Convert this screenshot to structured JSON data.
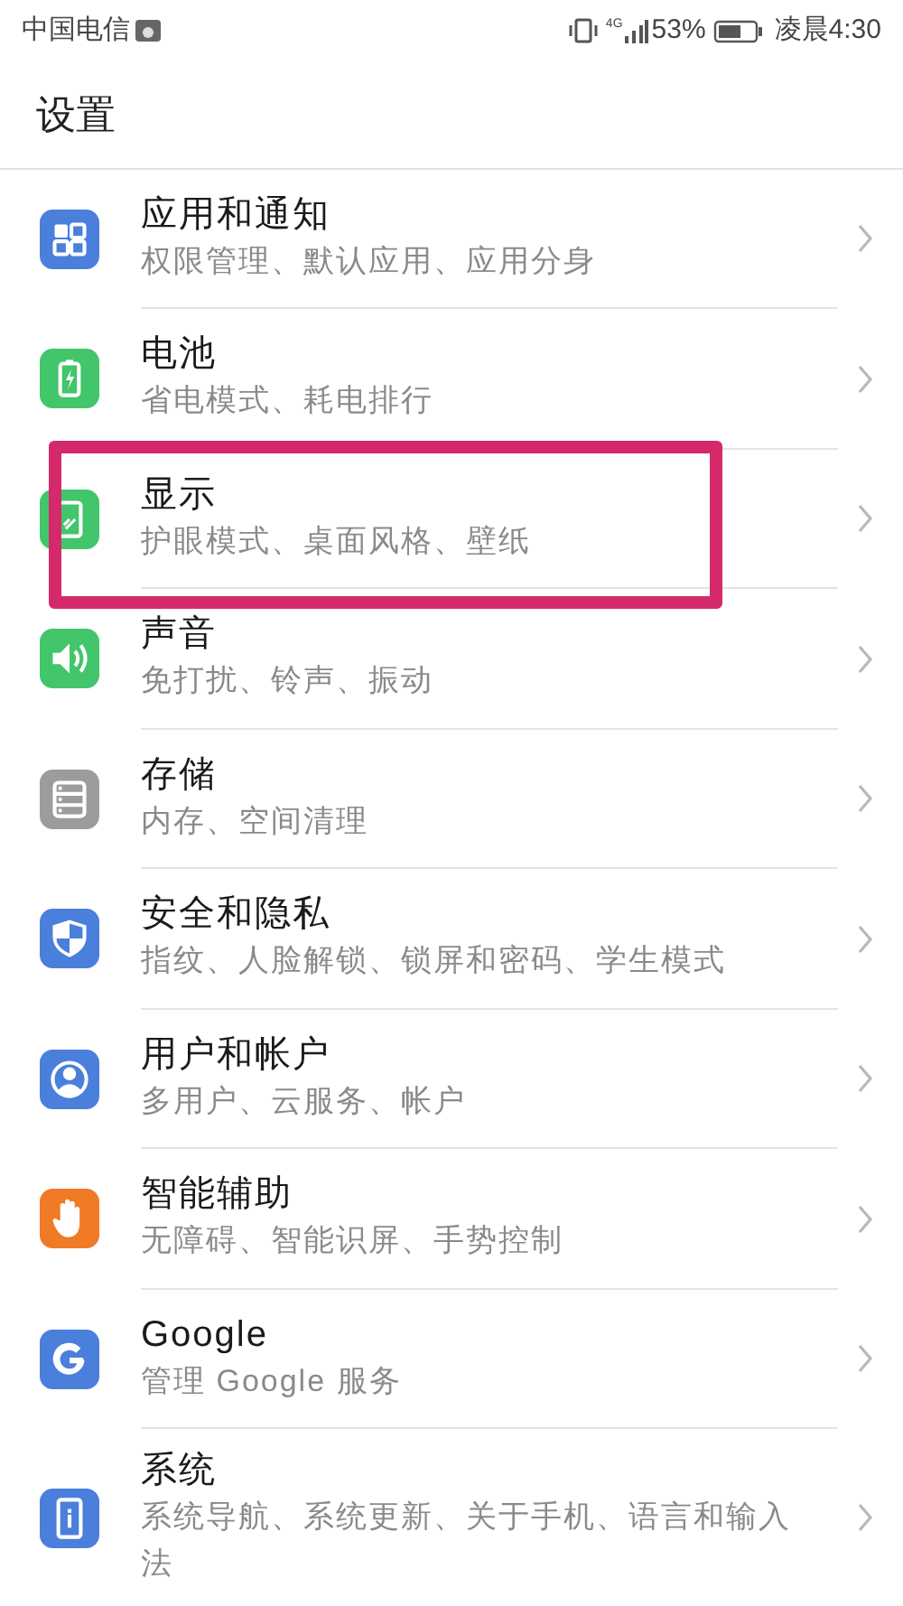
{
  "status_bar": {
    "carrier": "中国电信",
    "network": "4G",
    "battery": "53%",
    "time": "凌晨4:30"
  },
  "title": "设置",
  "items": [
    {
      "title": "应用和通知",
      "subtitle": "权限管理、默认应用、应用分身",
      "color": "#4a7fdc",
      "highlighted": false
    },
    {
      "title": "电池",
      "subtitle": "省电模式、耗电排行",
      "color": "#42c56b",
      "highlighted": false
    },
    {
      "title": "显示",
      "subtitle": "护眼模式、桌面风格、壁纸",
      "color": "#42c56b",
      "highlighted": true
    },
    {
      "title": "声音",
      "subtitle": "免打扰、铃声、振动",
      "color": "#42c56b",
      "highlighted": false
    },
    {
      "title": "存储",
      "subtitle": "内存、空间清理",
      "color": "#9c9c9c",
      "highlighted": false
    },
    {
      "title": "安全和隐私",
      "subtitle": "指纹、人脸解锁、锁屏和密码、学生模式",
      "color": "#4a7fdc",
      "highlighted": false
    },
    {
      "title": "用户和帐户",
      "subtitle": "多用户、云服务、帐户",
      "color": "#4a7fdc",
      "highlighted": false
    },
    {
      "title": "智能辅助",
      "subtitle": "无障碍、智能识屏、手势控制",
      "color": "#f07a26",
      "highlighted": false
    },
    {
      "title": "Google",
      "subtitle": "管理 Google 服务",
      "color": "#4a7fdc",
      "highlighted": false
    },
    {
      "title": "系统",
      "subtitle": "系统导航、系统更新、关于手机、语言和输入法",
      "color": "#4a7fdc",
      "highlighted": false
    }
  ]
}
